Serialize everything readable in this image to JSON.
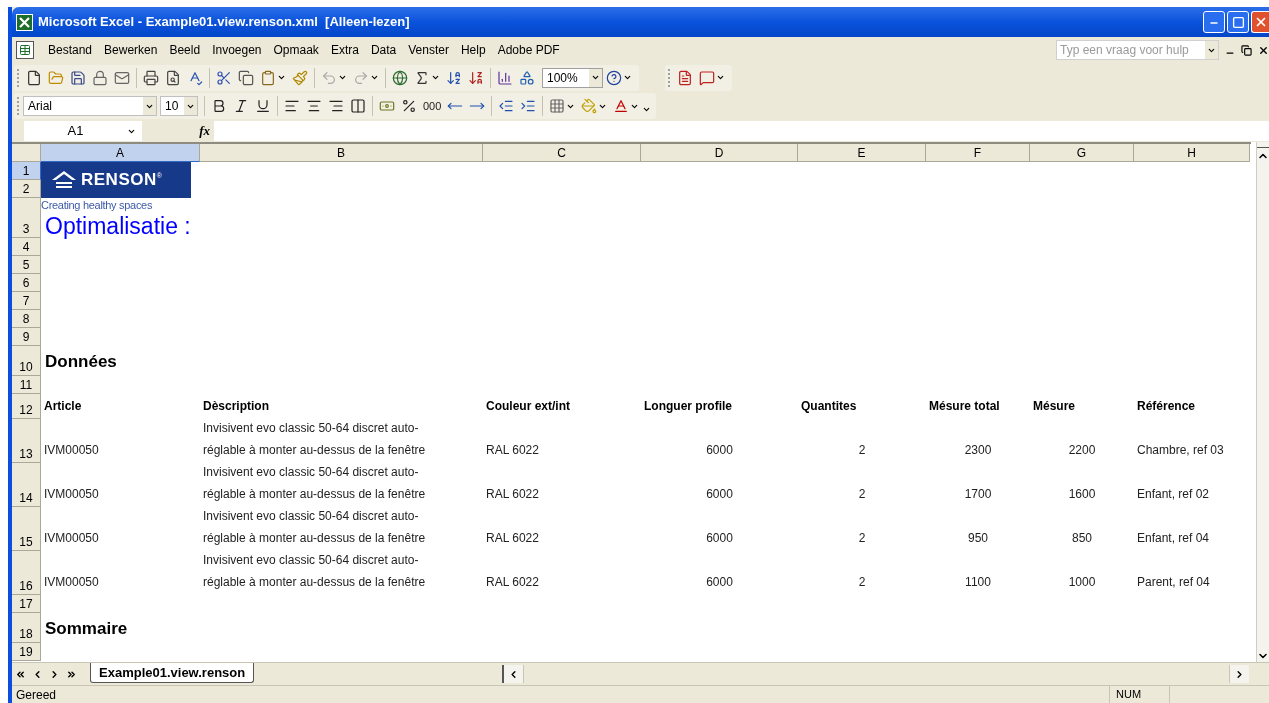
{
  "window": {
    "title": "Microsoft Excel - Example01.view.renson.xml  [Alleen-lezen]"
  },
  "menu_bar": {
    "items": [
      "Bestand",
      "Bewerken",
      "Beeld",
      "Invoegen",
      "Opmaak",
      "Extra",
      "Data",
      "Venster",
      "Help",
      "Adobe PDF"
    ],
    "help_field": {
      "placeholder": "Typ een vraag voor hulp"
    }
  },
  "standard_toolbar": {
    "groups": [
      [
        {
          "kind": "new",
          "disabled": false,
          "dropdown": false
        },
        {
          "kind": "open",
          "disabled": false,
          "dropdown": false
        },
        {
          "kind": "save",
          "disabled": false,
          "dropdown": false
        },
        {
          "kind": "permission",
          "disabled": false,
          "dropdown": false
        },
        {
          "kind": "mail",
          "disabled": false,
          "dropdown": false
        }
      ],
      [
        {
          "kind": "print",
          "disabled": false,
          "dropdown": false
        },
        {
          "kind": "preview",
          "disabled": false,
          "dropdown": false
        },
        {
          "kind": "spelling",
          "disabled": false,
          "dropdown": false
        }
      ],
      [
        {
          "kind": "cut",
          "disabled": false,
          "dropdown": false
        },
        {
          "kind": "copy",
          "disabled": false,
          "dropdown": false
        },
        {
          "kind": "paste",
          "disabled": false,
          "dropdown": true
        },
        {
          "kind": "painter",
          "disabled": false,
          "dropdown": false
        }
      ],
      [
        {
          "kind": "undo",
          "disabled": true,
          "dropdown": true
        },
        {
          "kind": "redo",
          "disabled": true,
          "dropdown": true
        }
      ],
      [
        {
          "kind": "hyperlink",
          "disabled": false,
          "dropdown": false
        },
        {
          "kind": "autosum",
          "disabled": false,
          "dropdown": true
        },
        {
          "kind": "sort_asc",
          "disabled": false,
          "dropdown": false
        },
        {
          "kind": "sort_desc",
          "disabled": false,
          "dropdown": false
        }
      ],
      [
        {
          "kind": "chart",
          "disabled": false,
          "dropdown": false
        },
        {
          "kind": "drawing",
          "disabled": false,
          "dropdown": false
        },
        {
          "kind": "zoom",
          "value": "100%",
          "disabled": false,
          "dropdown": true
        },
        {
          "kind": "help",
          "disabled": false,
          "dropdown": true
        }
      ]
    ]
  },
  "pdf_toolbar": {
    "groups": [
      [
        {
          "kind": "pdf",
          "disabled": false,
          "dropdown": false
        },
        {
          "kind": "pdf_comment",
          "disabled": false,
          "dropdown": true
        }
      ]
    ]
  },
  "formatting_toolbar": {
    "groups": [
      [
        {
          "kind": "font",
          "value": "Arial",
          "disabled": false,
          "dropdown": true
        },
        {
          "kind": "size",
          "value": "10",
          "disabled": false,
          "dropdown": true
        }
      ],
      [
        {
          "kind": "bold",
          "disabled": false,
          "dropdown": false
        },
        {
          "kind": "italic",
          "disabled": false,
          "dropdown": false
        },
        {
          "kind": "underline",
          "disabled": false,
          "dropdown": false
        }
      ],
      [
        {
          "kind": "align_left",
          "disabled": false,
          "dropdown": false
        },
        {
          "kind": "align_center",
          "disabled": false,
          "dropdown": false
        },
        {
          "kind": "align_right",
          "disabled": false,
          "dropdown": false
        },
        {
          "kind": "merge",
          "disabled": false,
          "dropdown": false
        }
      ],
      [
        {
          "kind": "currency",
          "disabled": false,
          "dropdown": false
        },
        {
          "kind": "percent",
          "disabled": false,
          "dropdown": false
        },
        {
          "kind": "thousands",
          "value": "000",
          "disabled": false,
          "dropdown": false
        },
        {
          "kind": "inc_decimal",
          "disabled": false,
          "dropdown": false
        },
        {
          "kind": "dec_decimal",
          "disabled": false,
          "dropdown": false
        }
      ],
      [
        {
          "kind": "outdent",
          "disabled": false,
          "dropdown": false
        },
        {
          "kind": "indent",
          "disabled": false,
          "dropdown": false
        }
      ],
      [
        {
          "kind": "borders",
          "disabled": false,
          "dropdown": true
        },
        {
          "kind": "fill",
          "disabled": false,
          "dropdown": true
        },
        {
          "kind": "font_color",
          "disabled": false,
          "dropdown": true
        },
        {
          "kind": "options",
          "disabled": false,
          "dropdown": true
        }
      ]
    ]
  },
  "formula_bar": {
    "name_box": "A1",
    "function_label": "fx"
  },
  "sheet": {
    "columns": [
      {
        "label": "A",
        "selected": true
      },
      {
        "label": "B",
        "selected": false
      },
      {
        "label": "C",
        "selected": false
      },
      {
        "label": "D",
        "selected": false
      },
      {
        "label": "E",
        "selected": false
      },
      {
        "label": "F",
        "selected": false
      },
      {
        "label": "G",
        "selected": false
      },
      {
        "label": "H",
        "selected": false
      }
    ],
    "logo": {
      "brand": "RENSON",
      "trademark": "®",
      "tagline": "Creating healthy spaces"
    },
    "rows": [
      {
        "number": "1",
        "selected": true,
        "kind": "blank"
      },
      {
        "number": "2",
        "selected": false,
        "kind": "blank"
      },
      {
        "number": "3",
        "selected": false,
        "kind": "title",
        "text": "Optimalisatie :"
      },
      {
        "number": "4",
        "selected": false,
        "kind": "blank"
      },
      {
        "number": "5",
        "selected": false,
        "kind": "blank"
      },
      {
        "number": "6",
        "selected": false,
        "kind": "blank"
      },
      {
        "number": "7",
        "selected": false,
        "kind": "blank"
      },
      {
        "number": "8",
        "selected": false,
        "kind": "blank"
      },
      {
        "number": "9",
        "selected": false,
        "kind": "blank"
      },
      {
        "number": "10",
        "selected": false,
        "kind": "section",
        "text": "Données"
      },
      {
        "number": "11",
        "selected": false,
        "kind": "blank"
      },
      {
        "number": "12",
        "selected": false,
        "kind": "header",
        "cells": [
          "Article",
          "Dèscription",
          "Couleur ext/int",
          "Longuer profile",
          "Quantites",
          "Mésure total",
          "Mésure",
          "Référence"
        ]
      },
      {
        "number": "13",
        "selected": false,
        "kind": "data",
        "cells": [
          "IVM00050",
          "Invisivent evo classic 50-64 discret auto-\nréglable à monter au-dessus de la fenêtre",
          "RAL 6022",
          "6000",
          "2",
          "2300",
          "2200",
          "Chambre, ref 03"
        ]
      },
      {
        "number": "14",
        "selected": false,
        "kind": "data",
        "cells": [
          "IVM00050",
          "Invisivent evo classic 50-64 discret auto-\nréglable à monter au-dessus de la fenêtre",
          "RAL 6022",
          "6000",
          "2",
          "1700",
          "1600",
          "Enfant, ref 02"
        ]
      },
      {
        "number": "15",
        "selected": false,
        "kind": "data",
        "cells": [
          "IVM00050",
          "Invisivent evo classic 50-64 discret auto-\nréglable à monter au-dessus de la fenêtre",
          "RAL 6022",
          "6000",
          "2",
          "950",
          "850",
          "Enfant, ref 04"
        ]
      },
      {
        "number": "16",
        "selected": false,
        "kind": "data",
        "cells": [
          "IVM00050",
          "Invisivent evo classic 50-64 discret auto-\nréglable à monter au-dessus de la fenêtre",
          "RAL 6022",
          "6000",
          "2",
          "1100",
          "1000",
          "Parent, ref 04"
        ]
      },
      {
        "number": "17",
        "selected": false,
        "kind": "blank"
      },
      {
        "number": "18",
        "selected": false,
        "kind": "section",
        "text": "Sommaire"
      },
      {
        "number": "19",
        "selected": false,
        "kind": "blank"
      }
    ]
  },
  "sheet_tabs": [
    {
      "label": "Example01.view.renson",
      "selected": true
    }
  ],
  "status_bar": {
    "text": "Gereed",
    "indicators": [
      "NUM"
    ]
  }
}
